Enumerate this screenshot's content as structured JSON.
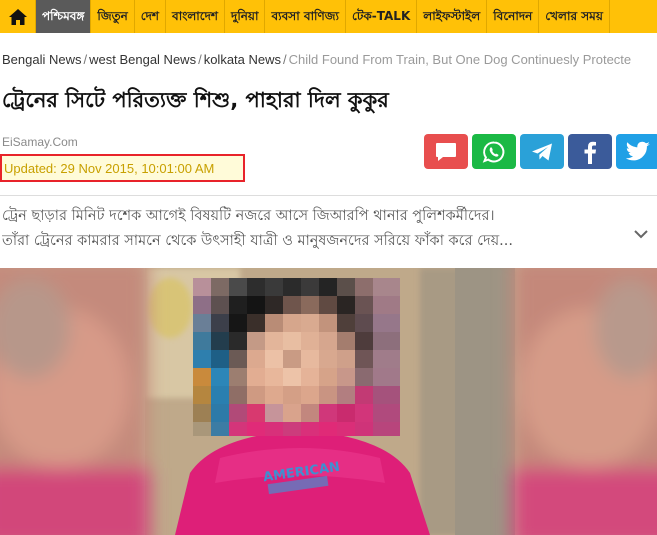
{
  "nav": {
    "home_icon": "home-icon",
    "items": [
      {
        "label": "পশ্চিমবঙ্গ",
        "active": true
      },
      {
        "label": "জিতুন",
        "active": false
      },
      {
        "label": "দেশ",
        "active": false
      },
      {
        "label": "বাংলাদেশ",
        "active": false
      },
      {
        "label": "দুনিয়া",
        "active": false
      },
      {
        "label": "ব্যবসা বাণিজ্য",
        "active": false
      },
      {
        "label": "টেক-TALK",
        "active": false
      },
      {
        "label": "লাইফস্টাইল",
        "active": false
      },
      {
        "label": "বিনোদন",
        "active": false
      },
      {
        "label": "খেলার সময়",
        "active": false
      }
    ]
  },
  "breadcrumb": {
    "items": [
      "Bengali News",
      "west Bengal News",
      "kolkata News"
    ],
    "separator": "/",
    "current": "Child Found From Train, But One Dog Continuesly Protecte"
  },
  "article": {
    "headline": "ট্রেনের সিটে পরিত্যক্ত শিশু, পাহারা দিল কুকুর",
    "site_name": "EiSamay.Com",
    "updated": "Updated: 29 Nov 2015, 10:01:00 AM",
    "summary_line1": "ট্রেন ছাড়ার মিনিট দশেক আগেই বিষয়টি নজরে আসে জিআরপি থানার পুলিশকর্মীদের।",
    "summary_line2": "তাঁরা ট্রেনের কামরার সামনে থেকে উৎসাহী যাত্রী ও মানুষজনদের সরিয়ে ফাঁকা করে দেয়..."
  },
  "share": [
    {
      "name": "comment",
      "icon": "comment-icon",
      "color": "#e84e4e"
    },
    {
      "name": "whatsapp",
      "icon": "whatsapp-icon",
      "color": "#1bb945"
    },
    {
      "name": "telegram",
      "icon": "telegram-icon",
      "color": "#2aa1d8"
    },
    {
      "name": "facebook",
      "icon": "facebook-icon",
      "color": "#3b5b9a"
    },
    {
      "name": "twitter",
      "icon": "twitter-icon",
      "color": "#20a0e6"
    }
  ],
  "colors": {
    "nav_bg": "#ffc107",
    "nav_active": "#5a5a5a",
    "highlight_border": "#e8232a",
    "updated_text": "#c8a000"
  },
  "photo": {
    "shirt_print": "AMERICAN"
  }
}
